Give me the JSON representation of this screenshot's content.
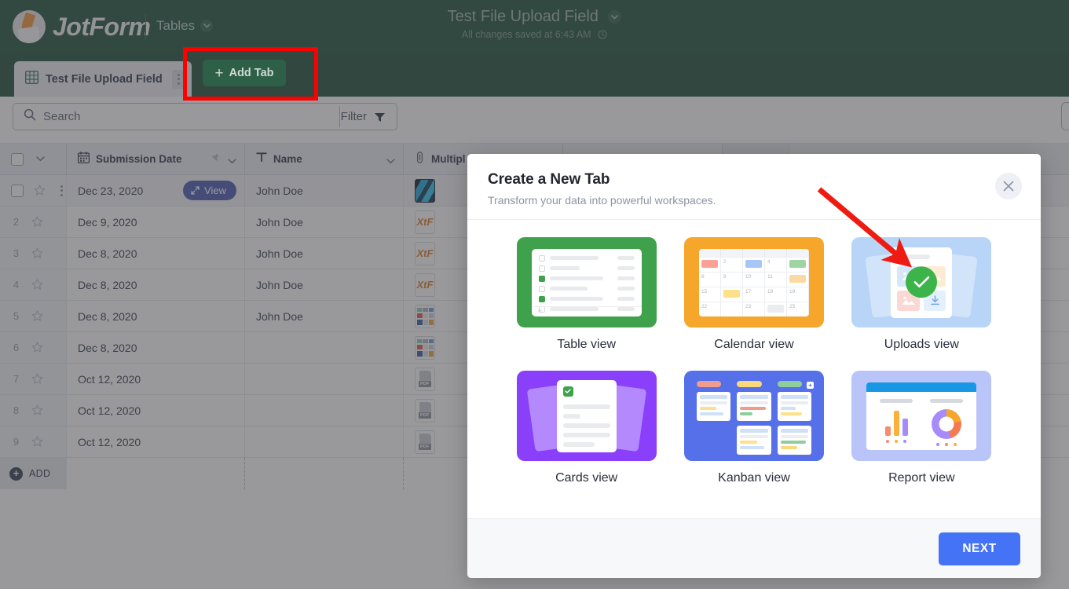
{
  "header": {
    "brand": "JotForm",
    "nav_label": "Tables",
    "form_title": "Test File Upload Field",
    "save_status": "All changes saved at 6:43 AM"
  },
  "tabs": {
    "active_tab": "Test File Upload Field",
    "add_tab_label": "Add Tab",
    "add_tab_plus": "+"
  },
  "toolbar": {
    "search_placeholder": "Search",
    "filter_label": "Filter"
  },
  "table": {
    "columns": [
      {
        "label": "Submission Date",
        "icon": "calendar-icon"
      },
      {
        "label": "Name",
        "icon": "text-icon"
      },
      {
        "label": "Multipl",
        "icon": "paperclip-icon"
      }
    ],
    "view_button": "View",
    "add_row_label": "ADD",
    "rows": [
      {
        "index": "",
        "date": "Dec 23, 2020",
        "name": "John Doe",
        "file": "photo"
      },
      {
        "index": "2",
        "date": "Dec 9, 2020",
        "name": "John Doe",
        "file": "xtf"
      },
      {
        "index": "3",
        "date": "Dec 8, 2020",
        "name": "John Doe",
        "file": "xtf"
      },
      {
        "index": "4",
        "date": "Dec 8, 2020",
        "name": "John Doe",
        "file": "xtf"
      },
      {
        "index": "5",
        "date": "Dec 8, 2020",
        "name": "John Doe",
        "file": "collage"
      },
      {
        "index": "6",
        "date": "Dec 8, 2020",
        "name": "",
        "file": "collage"
      },
      {
        "index": "7",
        "date": "Oct 12, 2020",
        "name": "",
        "file": "pdf"
      },
      {
        "index": "8",
        "date": "Oct 12, 2020",
        "name": "",
        "file": "pdf"
      },
      {
        "index": "9",
        "date": "Oct 12, 2020",
        "name": "",
        "file": "pdf"
      }
    ]
  },
  "modal": {
    "title": "Create a New Tab",
    "subtitle": "Transform your data into powerful workspaces.",
    "close_icon": "close-icon",
    "next_label": "NEXT",
    "views": [
      {
        "label": "Table view",
        "color": "#3fa14b"
      },
      {
        "label": "Calendar view",
        "color": "#f6a62a"
      },
      {
        "label": "Uploads view",
        "color": "#b8d5f7"
      },
      {
        "label": "Cards view",
        "color": "#8a3ffb"
      },
      {
        "label": "Kanban view",
        "color": "#5570e8"
      },
      {
        "label": "Report view",
        "color": "#b9c4f8"
      }
    ]
  },
  "calendar_art": {
    "week1": [
      "",
      "2",
      "",
      "4",
      ""
    ],
    "week2": [
      "8",
      "9",
      "10",
      "11",
      ""
    ],
    "week3": [
      "15",
      "",
      "17",
      "18",
      "19"
    ],
    "week4": [
      "22",
      "",
      "23",
      "",
      "25"
    ]
  },
  "annotations": {
    "highlight_color": "#fe0000",
    "arrow_color": "#ee1b12",
    "highlight_target": "add-tab-button",
    "arrow_target": "uploads-view-card"
  }
}
